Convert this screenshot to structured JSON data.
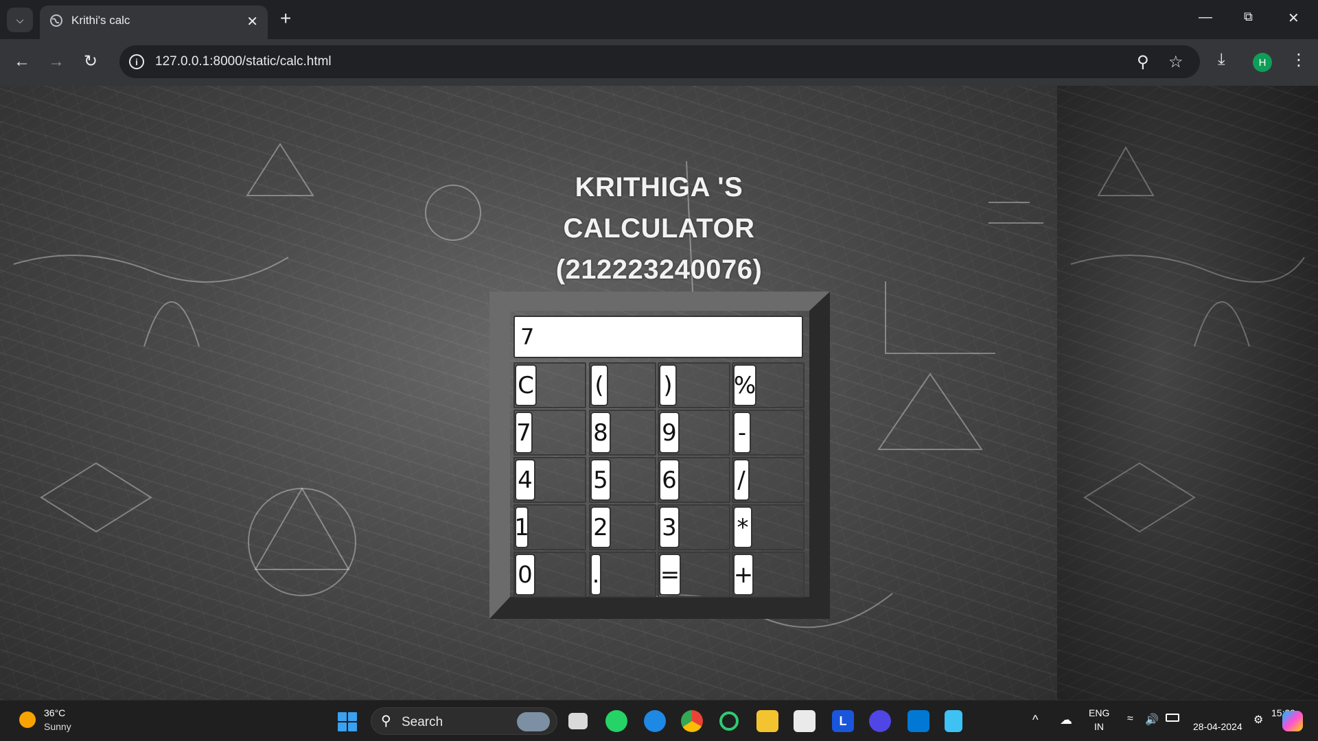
{
  "browser": {
    "tab_title": "Krithi's calc",
    "url": "127.0.0.1:8000/static/calc.html",
    "profile_initial": "H"
  },
  "page": {
    "title_line1": "KRITHIGA 'S",
    "title_line2": "CALCULATOR",
    "title_line3": "(212223240076)",
    "display_value": "7",
    "keys": [
      "C",
      "(",
      ")",
      "%",
      "7",
      "8",
      "9",
      "-",
      "4",
      "5",
      "6",
      "/",
      "1",
      "2",
      "3",
      "*",
      "0",
      ".",
      "=",
      "+"
    ]
  },
  "taskbar": {
    "temperature": "36°C",
    "weather": "Sunny",
    "search_label": "Search",
    "lang_line1": "ENG",
    "lang_line2": "IN",
    "time": "15:39",
    "date": "28-04-2024",
    "app_letter": "L"
  },
  "colors": {
    "accent_profile": "#0f9d58",
    "start_blue": "#3aa0f0"
  }
}
